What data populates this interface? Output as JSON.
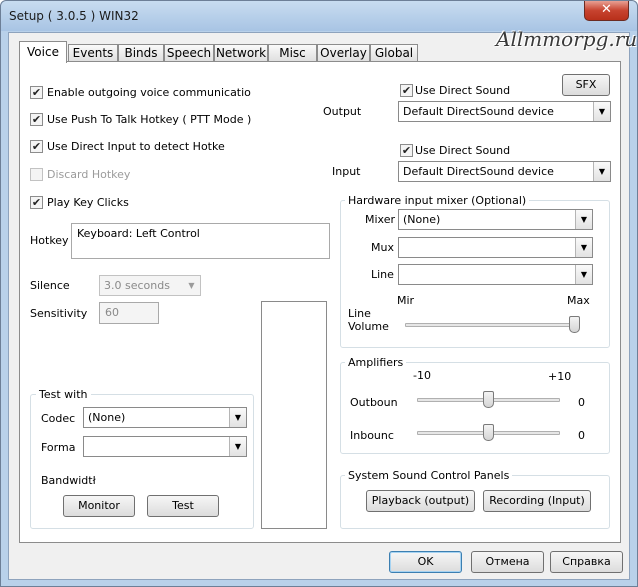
{
  "window": {
    "title": "Setup ( 3.0.5 ) WIN32",
    "watermark": "Allmmorpg.ru",
    "close_glyph": "✕"
  },
  "tabs": [
    {
      "label": "Voice",
      "active": true
    },
    {
      "label": "Events"
    },
    {
      "label": "Binds"
    },
    {
      "label": "Speech"
    },
    {
      "label": "Network"
    },
    {
      "label": "Misc"
    },
    {
      "label": "Overlay"
    },
    {
      "label": "Global"
    }
  ],
  "voice": {
    "enable_outgoing": {
      "label": "Enable outgoing voice communicatio",
      "checked": true
    },
    "push_to_talk": {
      "label": "Use Push To Talk Hotkey ( PTT Mode )",
      "checked": true
    },
    "direct_input": {
      "label": "Use Direct Input to detect Hotke",
      "checked": true
    },
    "discard_hotkey": {
      "label": "Discard Hotkey",
      "checked": false,
      "disabled": true
    },
    "play_key_clicks": {
      "label": "Play Key Clicks",
      "checked": true
    },
    "hotkey": {
      "label": "Hotkey",
      "value": "Keyboard: Left Control"
    },
    "silence": {
      "label": "Silence",
      "value": "3.0 seconds"
    },
    "sensitivity": {
      "label": "Sensitivity",
      "value": "60"
    },
    "check_glyph": "✔",
    "dropdown_glyph": "▼"
  },
  "test_group": {
    "title": "Test with",
    "codec_label": "Codec",
    "codec_value": "(None)",
    "format_label": "Forma",
    "format_value": "",
    "bandwidth_label": "Bandwidtł",
    "monitor_button": "Monitor",
    "test_button": "Test"
  },
  "output": {
    "sfx_button": "SFX",
    "use_direct_sound_label": "Use Direct Sound",
    "use_direct_sound_checked": true,
    "label": "Output",
    "device": "Default DirectSound device"
  },
  "input": {
    "use_direct_sound_label": "Use Direct Sound",
    "use_direct_sound_checked": true,
    "label": "Input",
    "device": "Default DirectSound device"
  },
  "hardware_mixer": {
    "title": "Hardware input mixer (Optional)",
    "mixer_label": "Mixer",
    "mixer_value": "(None)",
    "mux_label": "Mux",
    "mux_value": "",
    "line_label": "Line",
    "line_value": "",
    "min_label": "Mir",
    "max_label": "Max",
    "line_volume_label_1": "Line",
    "line_volume_label_2": "Volume",
    "line_volume_level": 1.0
  },
  "amplifiers": {
    "title": "Amplifiers",
    "min_label": "-10",
    "max_label": "+10",
    "outbound_label": "Outboun",
    "outbound_value": "0",
    "inbound_label": "Inbounc",
    "inbound_value": "0"
  },
  "system_sound": {
    "title": "System Sound Control Panels",
    "playback_button": "Playback (output)",
    "recording_button": "Recording (Input)"
  },
  "footer": {
    "ok_button": "OK",
    "cancel_button": "Отмена",
    "help_button": "Справка"
  }
}
